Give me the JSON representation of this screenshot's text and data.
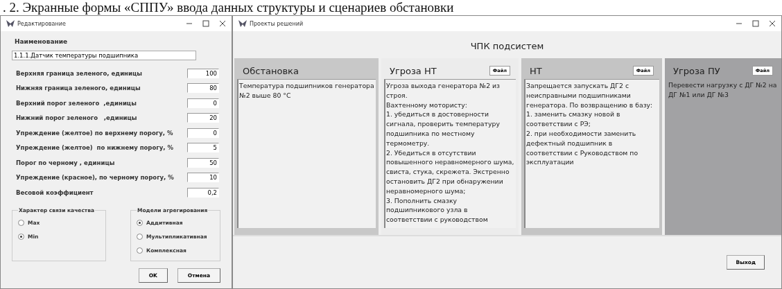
{
  "caption": ". 2. Экранные формы «СППУ» ввода данных структуры и сценариев обстановки",
  "edit_window": {
    "title": "Редактирование",
    "name_label": "Наименование",
    "name_value": "1.1.1.Датчик температуры подшипника",
    "fields": [
      {
        "label": "Верхняя граница зеленого, единицы",
        "value": "100"
      },
      {
        "label": "Нижняя граница зеленого, единицы",
        "value": "80"
      },
      {
        "label": "Верхний порог зеленого  ,единицы",
        "value": "0"
      },
      {
        "label": "Нижний порог зеленого   ,единицы",
        "value": "20"
      },
      {
        "label": "Упреждение (желтое) по верхнему порогу, %",
        "value": "0"
      },
      {
        "label": "Упреждение (желтое)  по нижнему порогу, %",
        "value": "5"
      },
      {
        "label": "Порог по черному , единицы",
        "value": "50"
      },
      {
        "label": "Упреждение (красное), по черному порогу, %",
        "value": "10"
      },
      {
        "label": "Весовой коэффициент",
        "value": "0,2"
      }
    ],
    "groups": [
      {
        "title": "Характер связи  качества",
        "options": [
          {
            "label": "Max",
            "selected": false
          },
          {
            "label": "Min",
            "selected": true
          }
        ]
      },
      {
        "title": "Модели агрегирования",
        "options": [
          {
            "label": "Аддитивная",
            "selected": true
          },
          {
            "label": "Мультипликативная",
            "selected": false
          },
          {
            "label": "Комплексная",
            "selected": false
          }
        ]
      }
    ],
    "buttons": [
      "OK",
      "Отмена"
    ]
  },
  "projects_window": {
    "title": "Проекты решений",
    "heading": "ЧПК подсистем",
    "columns": [
      {
        "title": "Обстановка",
        "text": "Температура подшипников генератора №2 выше 80 °C"
      },
      {
        "title": "Угроза НТ",
        "file_button": "Файл",
        "text": "Угроза выхода генератора №2 из строя.\nВахтенному мотористу:\n1. убедиться в достоверности сигнала, проверить температуру подшипника по местному термометру.\n2. Убедиться в отсутствии повышенного неравномерного шума, свиста, стука, скрежета. Экстренно остановить ДГ2 при обнаружении неравномерного шума;\n3. Пополнить смазку подшипникового узла в соответствии с руководством"
      },
      {
        "title": "НТ",
        "file_button": "Файл",
        "text": "Запрещается запускать ДГ2 с неисправными подшипниками генератора. По возвращению в базу:\n1. заменить смазку новой в соответствии с РЭ;\n2. при необходимости заменить дефектный подшипник в соответствии с Руководством по эксплуатации"
      },
      {
        "title": "Угроза ПУ",
        "file_button": "Файл",
        "text": "Перевести нагрузку с ДГ №2 на ДГ №1 или ДГ №3"
      }
    ],
    "exit_button": "Выход"
  }
}
